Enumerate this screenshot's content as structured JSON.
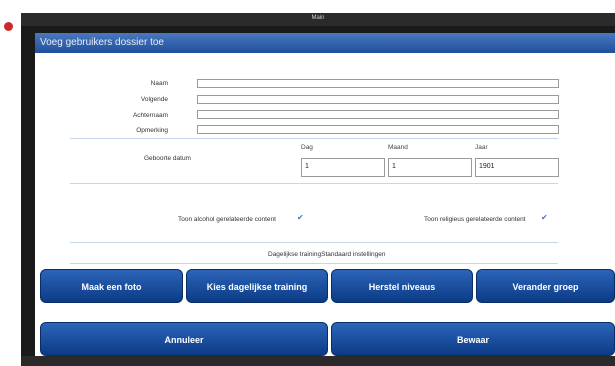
{
  "window": {
    "title": "Main"
  },
  "dialog": {
    "title": "Voeg gebruikers dossier toe"
  },
  "form": {
    "fields": [
      {
        "label": "Naam",
        "value": ""
      },
      {
        "label": "Volgende",
        "value": ""
      },
      {
        "label": "Achternaam",
        "value": ""
      },
      {
        "label": "Opmerking",
        "value": ""
      }
    ],
    "birthdate": {
      "label": "Geboorte datum",
      "day_label": "Dag",
      "month_label": "Maand",
      "year_label": "Jaar",
      "day": "1",
      "month": "1",
      "year": "1901"
    },
    "alcohol_label": "Toon alcohol gerelateerde content",
    "alcohol_checked": true,
    "religious_label": "Toon religieus gerelateerde content",
    "religious_checked": true,
    "training_line": "Dagelijkse trainingStandaard instellingen"
  },
  "buttons": {
    "photo": "Maak een foto",
    "daily_training": "Kies dagelijkse training",
    "restore_levels": "Herstel niveaus",
    "change_group": "Verander groep",
    "cancel": "Annuleer",
    "save": "Bewaar"
  },
  "icons": {
    "checkbox": "check-icon"
  },
  "colors": {
    "accent": "#1f4f9c",
    "button": "#0b3b86"
  }
}
